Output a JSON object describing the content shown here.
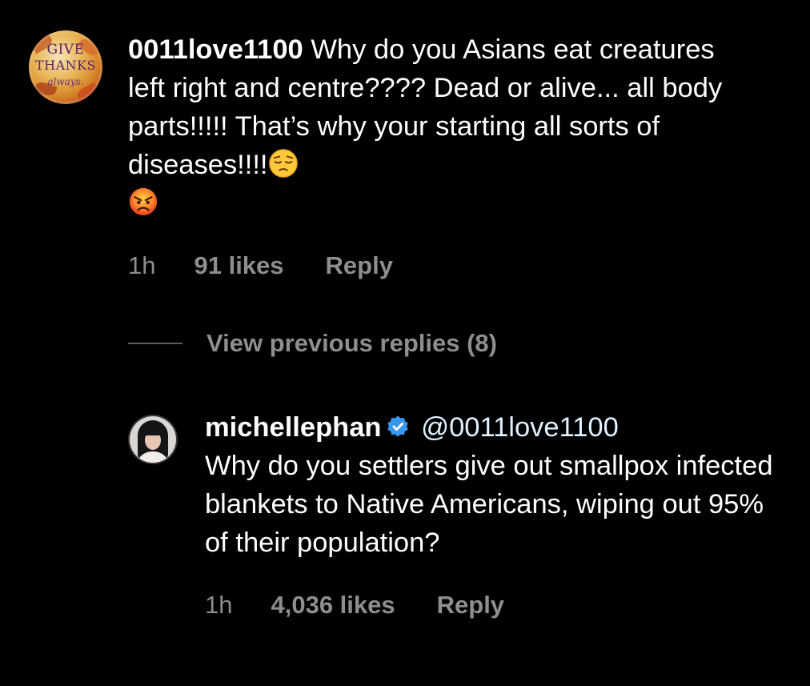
{
  "comment": {
    "avatar_text": [
      "GIVE",
      "THANKS",
      "always."
    ],
    "username": "0011love1100",
    "text": "Why do you Asians eat creatures left right and centre???? Dead or alive... all body parts!!!!! That’s why your starting all sorts of diseases!!!!",
    "emojis": [
      "pensive-face",
      "angry-face"
    ],
    "time": "1h",
    "likes": "91 likes",
    "reply_label": "Reply"
  },
  "thread": {
    "view_replies_label": "View previous replies (8)"
  },
  "reply": {
    "username": "michellephan",
    "verified": true,
    "mention": "@0011love1100",
    "text": "Why do you settlers give out smallpox infected blankets to Native Americans, wiping out 95% of their population?",
    "time": "1h",
    "likes": "4,036 likes",
    "reply_label": "Reply"
  },
  "colors": {
    "background": "#000000",
    "text": "#ffffff",
    "secondary": "#8e8e8e",
    "verified": "#3897f0"
  }
}
